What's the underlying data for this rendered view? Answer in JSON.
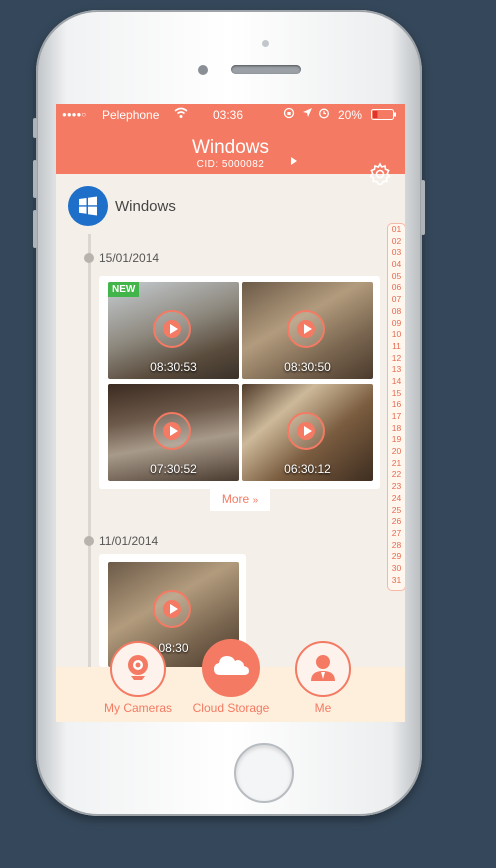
{
  "status": {
    "carrier": "Pelephone",
    "time": "03:36",
    "battery": "20%"
  },
  "header": {
    "title": "Windows",
    "cid": "CID: 5000082"
  },
  "camera": {
    "name": "Windows"
  },
  "groups": [
    {
      "date": "15/01/2014",
      "clips": [
        {
          "time": "08:30:53",
          "badge": "NEW"
        },
        {
          "time": "08:30:50"
        },
        {
          "time": "07:30:52"
        },
        {
          "time": "06:30:12"
        }
      ],
      "more_label": "More"
    },
    {
      "date": "11/01/2014",
      "clips": [
        {
          "time": "08:30"
        }
      ]
    }
  ],
  "day_index": [
    "01",
    "02",
    "03",
    "04",
    "05",
    "06",
    "07",
    "08",
    "09",
    "10",
    "11",
    "12",
    "13",
    "14",
    "15",
    "16",
    "17",
    "18",
    "19",
    "20",
    "21",
    "22",
    "23",
    "24",
    "25",
    "26",
    "27",
    "28",
    "29",
    "30",
    "31"
  ],
  "tabs": [
    {
      "label": "My Cameras",
      "icon": "webcam-icon"
    },
    {
      "label": "Cloud Storage",
      "icon": "cloud-icon"
    },
    {
      "label": "Me",
      "icon": "user-icon"
    }
  ],
  "colors": {
    "accent": "#f47a63",
    "windows_blue": "#1d6fc9",
    "new_badge": "#41b44a"
  }
}
